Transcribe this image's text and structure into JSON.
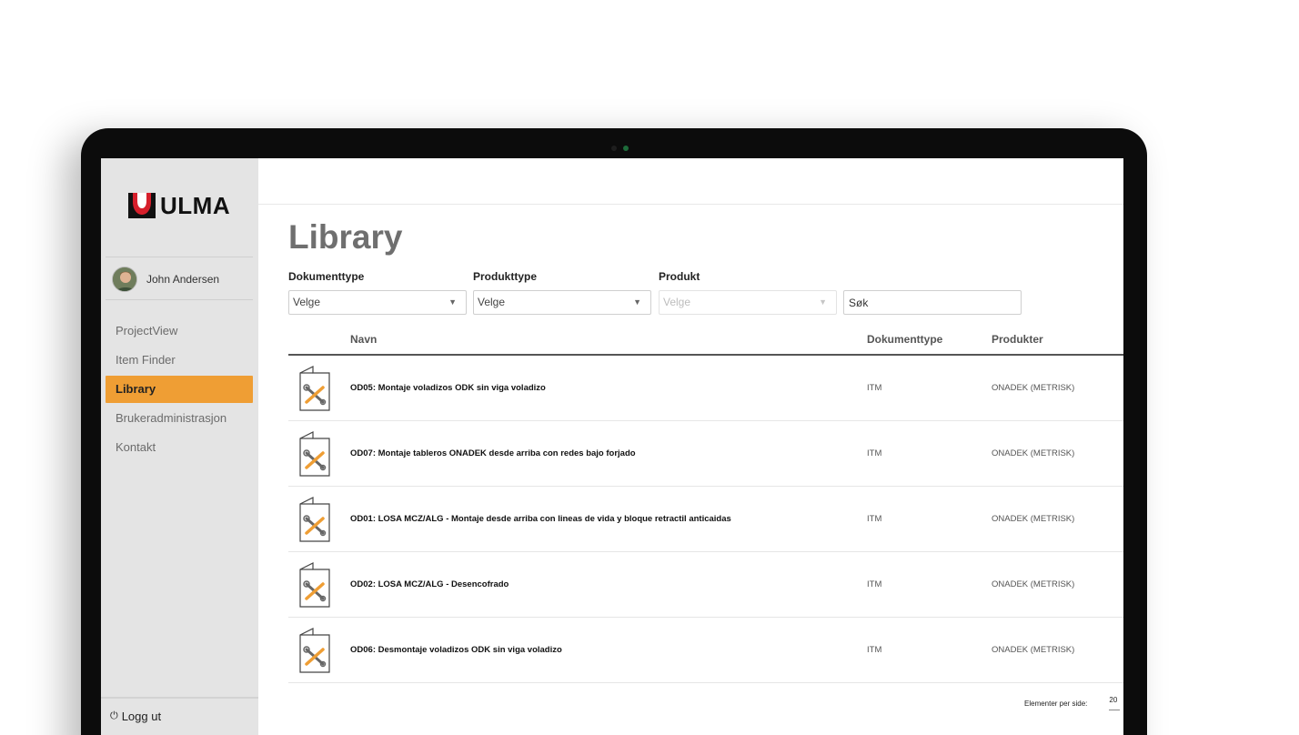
{
  "brand": {
    "name": "ULMA",
    "color": "#d61f2b"
  },
  "user": {
    "name": "John Andersen"
  },
  "sidebar": {
    "items": [
      {
        "label": "ProjectView",
        "active": false
      },
      {
        "label": "Item Finder",
        "active": false
      },
      {
        "label": "Library",
        "active": true
      },
      {
        "label": "Brukeradministrasjon",
        "active": false
      },
      {
        "label": "Kontakt",
        "active": false
      }
    ],
    "logout_label": "Logg ut",
    "accent": "#ef9e34"
  },
  "page": {
    "title": "Library"
  },
  "filters": {
    "dokumenttype": {
      "label": "Dokumenttype",
      "value": "Velge"
    },
    "produkttype": {
      "label": "Produkttype",
      "value": "Velge"
    },
    "produkt": {
      "label": "Produkt",
      "value": "Velge"
    },
    "search_placeholder": "Søk"
  },
  "table": {
    "headers": {
      "name": "Navn",
      "type": "Dokumenttype",
      "products": "Produkter"
    },
    "rows": [
      {
        "name": "OD05: Montaje voladizos ODK sin viga voladizo",
        "type": "ITM",
        "products": "ONADEK (METRISK)"
      },
      {
        "name": "OD07: Montaje tableros ONADEK desde arriba con redes bajo forjado",
        "type": "ITM",
        "products": "ONADEK (METRISK)"
      },
      {
        "name": "OD01: LOSA MCZ/ALG - Montaje desde arriba con lineas de vida y bloque retractil anticaidas",
        "type": "ITM",
        "products": "ONADEK (METRISK)"
      },
      {
        "name": "OD02: LOSA MCZ/ALG - Desencofrado",
        "type": "ITM",
        "products": "ONADEK (METRISK)"
      },
      {
        "name": "OD06: Desmontaje voladizos ODK sin viga voladizo",
        "type": "ITM",
        "products": "ONADEK (METRISK)"
      }
    ]
  },
  "pagination": {
    "label": "Elementer per side:",
    "value": "20"
  }
}
